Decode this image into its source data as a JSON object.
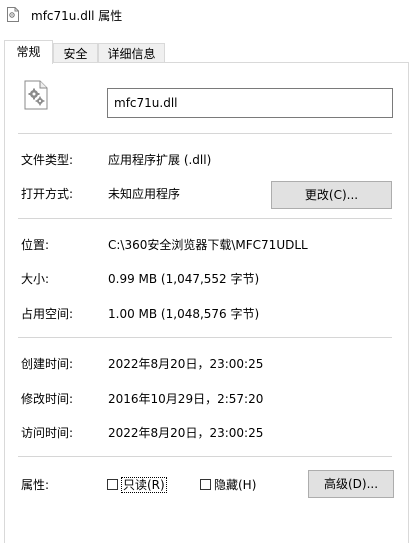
{
  "window": {
    "title": "mfc71u.dll 属性",
    "title_icon": "file-gear-icon"
  },
  "tabs": [
    {
      "label": "常规",
      "active": true
    },
    {
      "label": "安全",
      "active": false
    },
    {
      "label": "详细信息",
      "active": false
    }
  ],
  "file": {
    "icon": "dll-file-gear-icon",
    "name": "mfc71u.dll"
  },
  "info": {
    "type_label": "文件类型:",
    "type_value": "应用程序扩展 (.dll)",
    "opens_label": "打开方式:",
    "opens_value": "未知应用程序",
    "change_button": "更改(C)...",
    "location_label": "位置:",
    "location_value": "C:\\360安全浏览器下载\\MFC71UDLL",
    "size_label": "大小:",
    "size_value": "0.99 MB (1,047,552 字节)",
    "disk_label": "占用空间:",
    "disk_value": "1.00 MB (1,048,576 字节)",
    "created_label": "创建时间:",
    "created_value": "2022年8月20日，23:00:25",
    "modified_label": "修改时间:",
    "modified_value": "2016年10月29日，2:57:20",
    "accessed_label": "访问时间:",
    "accessed_value": "2022年8月20日，23:00:25"
  },
  "attributes": {
    "label": "属性:",
    "readonly": {
      "label": "只读(R)",
      "checked": false
    },
    "hidden": {
      "label": "隐藏(H)",
      "checked": false
    },
    "advanced_button": "高级(D)..."
  }
}
